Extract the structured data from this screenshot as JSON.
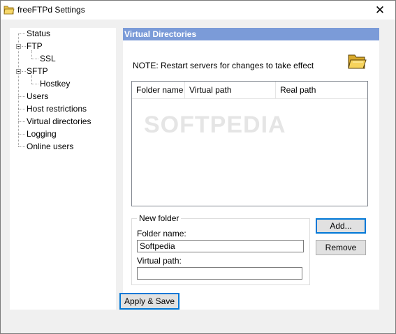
{
  "window": {
    "title": "freeFTPd Settings",
    "close_glyph": "✕"
  },
  "tree": {
    "items": [
      {
        "label": "Status"
      },
      {
        "label": "FTP"
      },
      {
        "label": "SSL"
      },
      {
        "label": "SFTP"
      },
      {
        "label": "Hostkey"
      },
      {
        "label": "Users"
      },
      {
        "label": "Host restrictions"
      },
      {
        "label": "Virtual directories"
      },
      {
        "label": "Logging"
      },
      {
        "label": "Online users"
      }
    ]
  },
  "panel": {
    "header": "Virtual Directories",
    "note": "NOTE: Restart servers for changes to take effect",
    "icon": "open-folder-icon",
    "columns": [
      "Folder name",
      "Virtual path",
      "Real path"
    ]
  },
  "new_folder": {
    "legend": "New folder",
    "folder_name_label": "Folder name:",
    "folder_name_value": "Softpedia",
    "virtual_path_label": "Virtual path:",
    "virtual_path_value": ""
  },
  "buttons": {
    "add": "Add...",
    "remove": "Remove",
    "apply_save": "Apply & Save"
  },
  "watermark": "SOFTPEDIA",
  "colors": {
    "header_bg": "#7b9bd8",
    "accent": "#0078d7"
  }
}
